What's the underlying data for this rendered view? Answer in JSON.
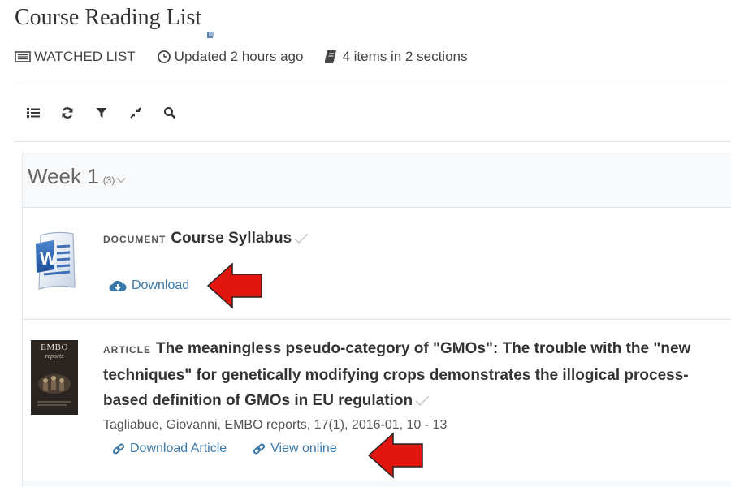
{
  "header": {
    "title": "Course Reading List",
    "edit_icon": "edit-icon"
  },
  "meta": {
    "watched": "WATCHED LIST",
    "updated": "Updated 2 hours ago",
    "items": "4 items in 2 sections"
  },
  "toolbar": {
    "icons": [
      "list-view-icon",
      "refresh-icon",
      "filter-icon",
      "collapse-icon",
      "search-icon"
    ]
  },
  "section": {
    "title": "Week 1",
    "count": "(3)"
  },
  "items": [
    {
      "type": "DOCUMENT",
      "title": "Course Syllabus",
      "thumbnail": "word-document-icon",
      "links": [
        "Download"
      ]
    },
    {
      "type": "ARTICLE",
      "title": "The meaningless pseudo-category of \"GMOs\": The trouble with the \"new techniques\" for genetically modifying crops demonstrates the illogical process-based definition of GMOs in EU regulation",
      "thumbnail_title": "EMBO",
      "thumbnail_subtitle": "reports",
      "citation": "Tagliabue, Giovanni, EMBO reports, 17(1), 2016-01, 10 - 13",
      "links": [
        "Download Article",
        "View online"
      ]
    }
  ],
  "colors": {
    "link": "#3b78a8",
    "arrow": "#e0160f",
    "section_bg": "#f7f9fa"
  }
}
